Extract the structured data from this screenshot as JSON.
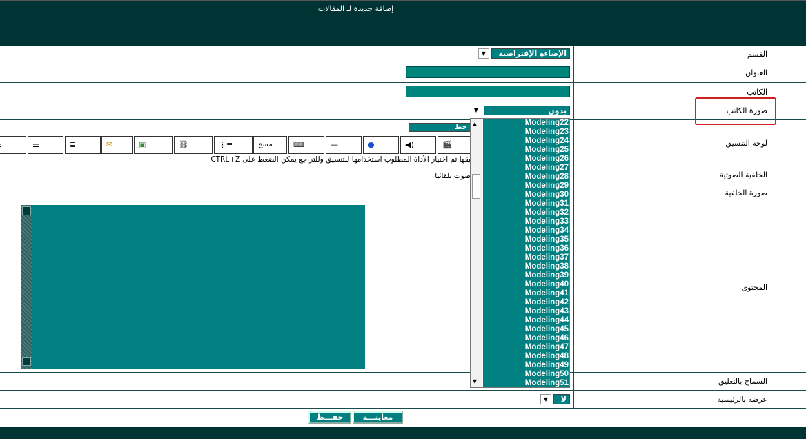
{
  "header": {
    "title": "إضافة جديدة لـ المقالات"
  },
  "form": {
    "section_label": "القسم",
    "section_value": "الإضاءة الإفتراضية",
    "title_label": "العنوان",
    "author_label": "الكاتب",
    "author_image_label": "صورة الكاتب",
    "author_image_value": "بدون",
    "format_panel_label": "لوحة التنسيق",
    "font_select": "خط",
    "format_hint": "يقها ثم اختيار الأداة المطلوب استخدامها للتنسيق وللتراجع يمكن الضغط على CTRL+Z",
    "bg_sound_label": "الخلفية الصوتية",
    "bg_sound_hint": "صوت تلقائيا",
    "bg_image_label": "صورة الخلفية",
    "content_label": "المحتوى",
    "allow_comments_label": "السماح بالتعليق",
    "show_home_label": "عرضه بالرئيسية",
    "show_home_value": "لا"
  },
  "toolbar": {
    "erase_label": "مسح"
  },
  "dropdown_options": [
    "Modeling22",
    "Modeling23",
    "Modeling24",
    "Modeling25",
    "Modeling26",
    "Modeling27",
    "Modeling28",
    "Modeling29",
    "Modeling30",
    "Modeling31",
    "Modeling32",
    "Modeling33",
    "Modeling34",
    "Modeling35",
    "Modeling36",
    "Modeling37",
    "Modeling38",
    "Modeling39",
    "Modeling40",
    "Modeling41",
    "Modeling42",
    "Modeling43",
    "Modeling44",
    "Modeling45",
    "Modeling46",
    "Modeling47",
    "Modeling48",
    "Modeling49",
    "Modeling50",
    "Modeling51"
  ],
  "buttons": {
    "save": "حفـــظ",
    "preview": "معاينـــة"
  },
  "colors": {
    "header_bg": "#003333",
    "accent": "#008080",
    "highlight": "#cc0000"
  }
}
